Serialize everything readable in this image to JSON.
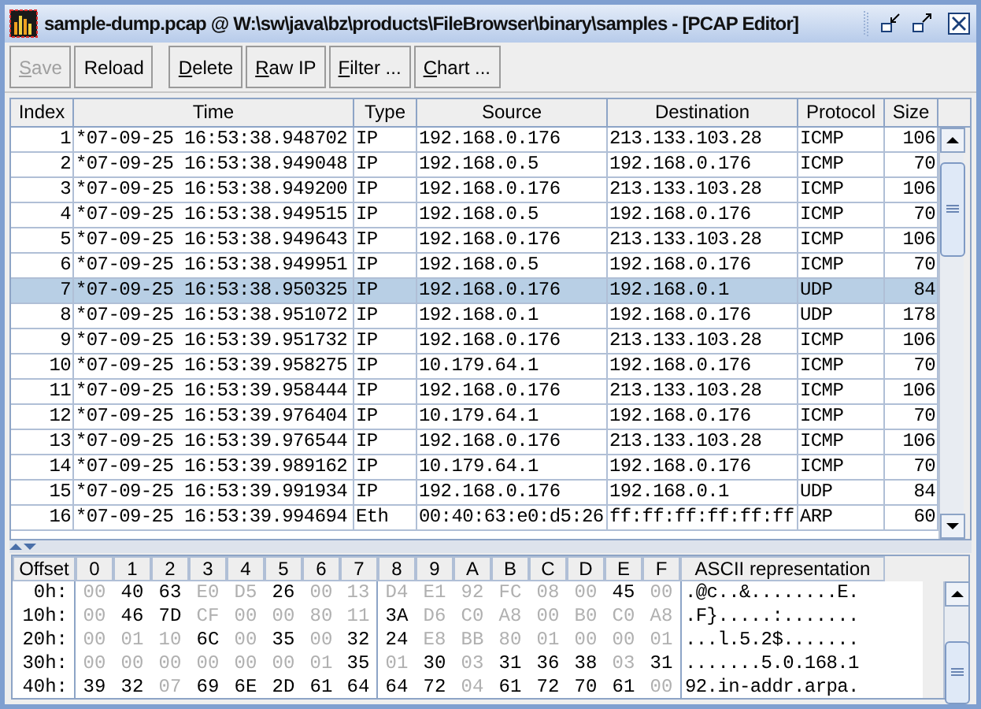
{
  "window": {
    "title": "sample-dump.pcap @ W:\\sw\\java\\bz\\products\\FileBrowser\\binary\\samples - [PCAP Editor]"
  },
  "toolbar": {
    "groups": [
      [
        {
          "label": "Save",
          "disabled": true,
          "mnemonic": true
        },
        {
          "label": "Reload",
          "disabled": false,
          "mnemonic": false
        }
      ],
      [
        {
          "label": "Delete",
          "disabled": false,
          "mnemonic": true
        },
        {
          "label": "Raw IP",
          "disabled": false,
          "mnemonic": true
        },
        {
          "label": "Filter ...",
          "disabled": false,
          "mnemonic": true
        },
        {
          "label": "Chart ...",
          "disabled": false,
          "mnemonic": true
        }
      ]
    ]
  },
  "packets": {
    "columns": [
      "Index",
      "Time",
      "Type",
      "Source",
      "Destination",
      "Protocol",
      "Size"
    ],
    "rows": [
      {
        "selected": false,
        "cells": [
          "1",
          "*07-09-25 16:53:38.948702",
          "IP",
          "192.168.0.176",
          "213.133.103.28",
          "ICMP",
          "106"
        ]
      },
      {
        "selected": false,
        "cells": [
          "2",
          "*07-09-25 16:53:38.949048",
          "IP",
          "192.168.0.5",
          "192.168.0.176",
          "ICMP",
          "70"
        ]
      },
      {
        "selected": false,
        "cells": [
          "3",
          "*07-09-25 16:53:38.949200",
          "IP",
          "192.168.0.176",
          "213.133.103.28",
          "ICMP",
          "106"
        ]
      },
      {
        "selected": false,
        "cells": [
          "4",
          "*07-09-25 16:53:38.949515",
          "IP",
          "192.168.0.5",
          "192.168.0.176",
          "ICMP",
          "70"
        ]
      },
      {
        "selected": false,
        "cells": [
          "5",
          "*07-09-25 16:53:38.949643",
          "IP",
          "192.168.0.176",
          "213.133.103.28",
          "ICMP",
          "106"
        ]
      },
      {
        "selected": false,
        "cells": [
          "6",
          "*07-09-25 16:53:38.949951",
          "IP",
          "192.168.0.5",
          "192.168.0.176",
          "ICMP",
          "70"
        ]
      },
      {
        "selected": true,
        "cells": [
          "7",
          "*07-09-25 16:53:38.950325",
          "IP",
          "192.168.0.176",
          "192.168.0.1",
          "UDP",
          "84"
        ]
      },
      {
        "selected": false,
        "cells": [
          "8",
          "*07-09-25 16:53:38.951072",
          "IP",
          "192.168.0.1",
          "192.168.0.176",
          "UDP",
          "178"
        ]
      },
      {
        "selected": false,
        "cells": [
          "9",
          "*07-09-25 16:53:39.951732",
          "IP",
          "192.168.0.176",
          "213.133.103.28",
          "ICMP",
          "106"
        ]
      },
      {
        "selected": false,
        "cells": [
          "10",
          "*07-09-25 16:53:39.958275",
          "IP",
          "10.179.64.1",
          "192.168.0.176",
          "ICMP",
          "70"
        ]
      },
      {
        "selected": false,
        "cells": [
          "11",
          "*07-09-25 16:53:39.958444",
          "IP",
          "192.168.0.176",
          "213.133.103.28",
          "ICMP",
          "106"
        ]
      },
      {
        "selected": false,
        "cells": [
          "12",
          "*07-09-25 16:53:39.976404",
          "IP",
          "10.179.64.1",
          "192.168.0.176",
          "ICMP",
          "70"
        ]
      },
      {
        "selected": false,
        "cells": [
          "13",
          "*07-09-25 16:53:39.976544",
          "IP",
          "192.168.0.176",
          "213.133.103.28",
          "ICMP",
          "106"
        ]
      },
      {
        "selected": false,
        "cells": [
          "14",
          "*07-09-25 16:53:39.989162",
          "IP",
          "10.179.64.1",
          "192.168.0.176",
          "ICMP",
          "70"
        ]
      },
      {
        "selected": false,
        "cells": [
          "15",
          "*07-09-25 16:53:39.991934",
          "IP",
          "192.168.0.176",
          "192.168.0.1",
          "UDP",
          "84"
        ]
      },
      {
        "selected": false,
        "cells": [
          "16",
          "*07-09-25 16:53:39.994694",
          "Eth",
          "00:40:63:e0:d5:26",
          "ff:ff:ff:ff:ff:ff",
          "ARP",
          "60"
        ]
      }
    ]
  },
  "hex": {
    "columns": [
      "Offset",
      "0",
      "1",
      "2",
      "3",
      "4",
      "5",
      "6",
      "7",
      "8",
      "9",
      "A",
      "B",
      "C",
      "D",
      "E",
      "F",
      "ASCII representation"
    ],
    "rows": [
      {
        "offset": "0h:",
        "ascii": ".@c..&........E.",
        "bytes": [
          {
            "v": "00",
            "printable": false
          },
          {
            "v": "40",
            "printable": true
          },
          {
            "v": "63",
            "printable": true
          },
          {
            "v": "E0",
            "printable": false
          },
          {
            "v": "D5",
            "printable": false
          },
          {
            "v": "26",
            "printable": true
          },
          {
            "v": "00",
            "printable": false
          },
          {
            "v": "13",
            "printable": false
          },
          {
            "v": "D4",
            "printable": false
          },
          {
            "v": "E1",
            "printable": false
          },
          {
            "v": "92",
            "printable": false
          },
          {
            "v": "FC",
            "printable": false
          },
          {
            "v": "08",
            "printable": false
          },
          {
            "v": "00",
            "printable": false
          },
          {
            "v": "45",
            "printable": true
          },
          {
            "v": "00",
            "printable": false
          }
        ]
      },
      {
        "offset": "10h:",
        "ascii": ".F}.....:.......",
        "bytes": [
          {
            "v": "00",
            "printable": false
          },
          {
            "v": "46",
            "printable": true
          },
          {
            "v": "7D",
            "printable": true
          },
          {
            "v": "CF",
            "printable": false
          },
          {
            "v": "00",
            "printable": false
          },
          {
            "v": "00",
            "printable": false
          },
          {
            "v": "80",
            "printable": false
          },
          {
            "v": "11",
            "printable": false
          },
          {
            "v": "3A",
            "printable": true
          },
          {
            "v": "D6",
            "printable": false
          },
          {
            "v": "C0",
            "printable": false
          },
          {
            "v": "A8",
            "printable": false
          },
          {
            "v": "00",
            "printable": false
          },
          {
            "v": "B0",
            "printable": false
          },
          {
            "v": "C0",
            "printable": false
          },
          {
            "v": "A8",
            "printable": false
          }
        ]
      },
      {
        "offset": "20h:",
        "ascii": "...l.5.2$.......",
        "bytes": [
          {
            "v": "00",
            "printable": false
          },
          {
            "v": "01",
            "printable": false
          },
          {
            "v": "10",
            "printable": false
          },
          {
            "v": "6C",
            "printable": true
          },
          {
            "v": "00",
            "printable": false
          },
          {
            "v": "35",
            "printable": true
          },
          {
            "v": "00",
            "printable": false
          },
          {
            "v": "32",
            "printable": true
          },
          {
            "v": "24",
            "printable": true
          },
          {
            "v": "E8",
            "printable": false
          },
          {
            "v": "BB",
            "printable": false
          },
          {
            "v": "80",
            "printable": false
          },
          {
            "v": "01",
            "printable": false
          },
          {
            "v": "00",
            "printable": false
          },
          {
            "v": "00",
            "printable": false
          },
          {
            "v": "01",
            "printable": false
          }
        ]
      },
      {
        "offset": "30h:",
        "ascii": ".......5.0.168.1",
        "bytes": [
          {
            "v": "00",
            "printable": false
          },
          {
            "v": "00",
            "printable": false
          },
          {
            "v": "00",
            "printable": false
          },
          {
            "v": "00",
            "printable": false
          },
          {
            "v": "00",
            "printable": false
          },
          {
            "v": "00",
            "printable": false
          },
          {
            "v": "01",
            "printable": false
          },
          {
            "v": "35",
            "printable": true
          },
          {
            "v": "01",
            "printable": false
          },
          {
            "v": "30",
            "printable": true
          },
          {
            "v": "03",
            "printable": false
          },
          {
            "v": "31",
            "printable": true
          },
          {
            "v": "36",
            "printable": true
          },
          {
            "v": "38",
            "printable": true
          },
          {
            "v": "03",
            "printable": false
          },
          {
            "v": "31",
            "printable": true
          }
        ]
      },
      {
        "offset": "40h:",
        "ascii": "92.in-addr.arpa.",
        "bytes": [
          {
            "v": "39",
            "printable": true
          },
          {
            "v": "32",
            "printable": true
          },
          {
            "v": "07",
            "printable": false
          },
          {
            "v": "69",
            "printable": true
          },
          {
            "v": "6E",
            "printable": true
          },
          {
            "v": "2D",
            "printable": true
          },
          {
            "v": "61",
            "printable": true
          },
          {
            "v": "64",
            "printable": true
          },
          {
            "v": "64",
            "printable": true
          },
          {
            "v": "72",
            "printable": true
          },
          {
            "v": "04",
            "printable": false
          },
          {
            "v": "61",
            "printable": true
          },
          {
            "v": "72",
            "printable": true
          },
          {
            "v": "70",
            "printable": true
          },
          {
            "v": "61",
            "printable": true
          },
          {
            "v": "00",
            "printable": false
          }
        ]
      }
    ]
  }
}
